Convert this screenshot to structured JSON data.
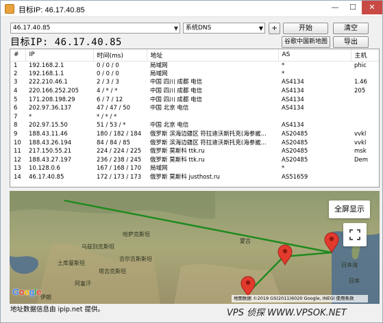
{
  "window": {
    "title": "目标IP: 46.17.40.85",
    "minimize": "—",
    "maximize": "☐",
    "close": "✕"
  },
  "toolbar": {
    "ip_value": "46.17.40.85",
    "dns_value": "系统DNS",
    "plus_label": "+",
    "start_label": "开始",
    "clear_label": "清空",
    "map_label": "谷歌中国新地图",
    "export_label": "导出",
    "target_label": "目标IP: 46.17.40.85"
  },
  "table": {
    "headers": [
      "#",
      "IP",
      "时间(ms)",
      "地址",
      "AS",
      "主机"
    ],
    "rows": [
      [
        "1",
        "192.168.2.1",
        "0 / 0 / 0",
        "局域网",
        "*",
        "phic"
      ],
      [
        "2",
        "192.168.1.1",
        "0 / 0 / 0",
        "局域网",
        "*",
        ""
      ],
      [
        "3",
        "222.210.46.1",
        "2 / 3 / 3",
        "中国 四川 成都 电信",
        "AS4134",
        "1.46"
      ],
      [
        "4",
        "220.166.252.205",
        "4 / * / *",
        "中国 四川 成都 电信",
        "AS4134",
        "205"
      ],
      [
        "5",
        "171.208.198.29",
        "6 / 7 / 12",
        "中国 四川 成都 电信",
        "AS4134",
        ""
      ],
      [
        "6",
        "202.97.36.137",
        "47 / 47 / 50",
        "中国 北京 电信",
        "AS4134",
        ""
      ],
      [
        "7",
        "*",
        "* / * / *",
        "",
        "",
        ""
      ],
      [
        "8",
        "202.97.15.50",
        "51 / 53 / *",
        "中国 北京 电信",
        "AS4134",
        ""
      ],
      [
        "9",
        "188.43.11.46",
        "180 / 182 / 184",
        "俄罗斯 滨海边疆区 符拉迪沃斯托克(海参崴...",
        "AS20485",
        "vvkl"
      ],
      [
        "10",
        "188.43.26.194",
        "84 / 84 / 85",
        "俄罗斯 滨海边疆区 符拉迪沃斯托克(海参崴...",
        "AS20485",
        "vvkl"
      ],
      [
        "11",
        "217.150.55.21",
        "224 / 224 / 225",
        "俄罗斯 莫斯科 ttk.ru",
        "AS20485",
        "msk"
      ],
      [
        "12",
        "188.43.27.197",
        "236 / 238 / 245",
        "俄罗斯 莫斯科 ttk.ru",
        "AS20485",
        "Dem"
      ],
      [
        "13",
        "10.128.0.6",
        "167 / 168 / 170",
        "局域网",
        "*",
        ""
      ],
      [
        "14",
        "46.17.40.85",
        "172 / 173 / 173",
        "俄罗斯 莫斯科 justhost.ru",
        "AS51659",
        ""
      ]
    ]
  },
  "map": {
    "fullscreen_label": "全屏显示",
    "google_logo": "Google",
    "attribution": "地图数据 ©2019 GS(2011)6020 Google, INEGI   使用条款",
    "labels": [
      "哈萨克斯坦",
      "蒙古",
      "乌兹别克斯坦",
      "吉尔吉斯斯坦",
      "土库曼斯坦",
      "塔吉克斯坦",
      "阿富汗",
      "伊朗",
      "日本海",
      "日本"
    ],
    "colors": {
      "route": "#1f8a1f",
      "marker": "#e33a2e"
    }
  },
  "footer": {
    "text": "地址数据信息由 ipip.net 提供。"
  },
  "watermark": "VPS 侦探 WWW.VPSOK.NET"
}
